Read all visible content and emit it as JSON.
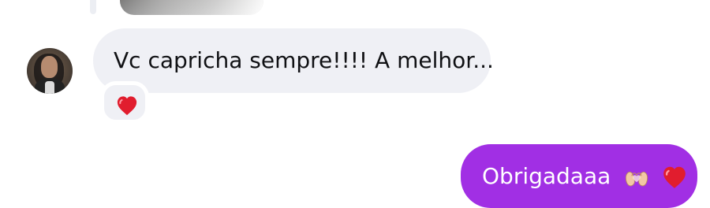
{
  "messages": {
    "incoming": {
      "text": "Vc capricha sempre!!!! A melhor..."
    },
    "outgoing": {
      "text": "Obrigadaaa"
    }
  },
  "icons": {
    "avatar": "avatar",
    "reaction": "heart-icon",
    "outgoing_emoji_1": "heart-hands-icon",
    "outgoing_emoji_2": "heart-icon"
  },
  "colors": {
    "incoming_bubble": "#eff0f5",
    "outgoing_bubble": "#a12fe4",
    "heart": "#e11d2e"
  }
}
